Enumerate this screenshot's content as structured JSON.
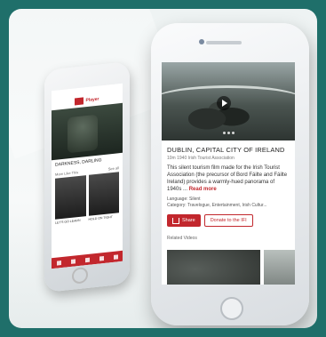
{
  "back_phone": {
    "app_title": "Player",
    "section_title": "DARKNESS, DARLING",
    "related_header": "More Like This",
    "related_more": "See all",
    "thumb_caption_1": "LET'S GO LEARN",
    "thumb_caption_2": "HOLD ON TIGHT"
  },
  "front_phone": {
    "film_title": "DUBLIN, CAPITAL CITY OF IRELAND",
    "meta": "10m   1940   Irish Tourist Association",
    "description": "This silent tourism film made for the Irish Tourist Association (the precursor of Bord Fáilte and Fáilte Ireland) provides a warmly-hued panorama of 1940s ...",
    "read_more": "Read more",
    "language": "Language: Silent",
    "category": "Category: Travelogue, Entertainment, Irish Cultur...",
    "share_label": "Share",
    "donate_label": "Donate to the IFI",
    "related_label": "Related Videos"
  },
  "colors": {
    "accent": "#c2272d",
    "background": "#1f6f6a"
  }
}
